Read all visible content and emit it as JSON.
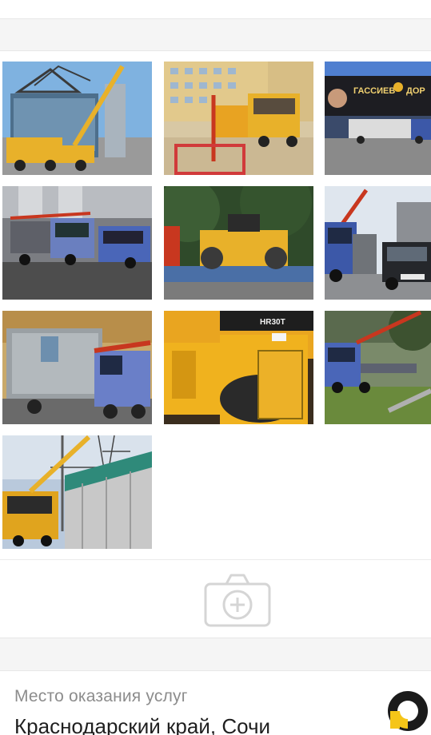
{
  "gallery": {
    "photos": [
      {
        "alt": "Кран-манипулятор у стеклянного здания",
        "icon": "photo-thumbnail"
      },
      {
        "alt": "Грузовик с краном у жилого дома",
        "icon": "photo-thumbnail"
      },
      {
        "alt": "Грузовик у рекламного экрана",
        "icon": "photo-thumbnail",
        "billboard_line1": "ГАССИЕВ",
        "billboard_line2": "ДОР"
      },
      {
        "alt": "Грузовики с манипулятором в ангаре",
        "icon": "photo-thumbnail"
      },
      {
        "alt": "Каток на платформе грузовика",
        "icon": "photo-thumbnail"
      },
      {
        "alt": "Синий грузовик с краном и внедорожник",
        "icon": "photo-thumbnail"
      },
      {
        "alt": "Перевозка бытовки краном-манипулятором",
        "icon": "photo-thumbnail"
      },
      {
        "alt": "Жёлтый дорожный каток крупным планом",
        "icon": "photo-thumbnail",
        "model": "HR30T"
      },
      {
        "alt": "Грузовик с краном на площадке",
        "icon": "photo-thumbnail"
      },
      {
        "alt": "Установка павильона краном",
        "icon": "photo-thumbnail"
      }
    ]
  },
  "add_photo": {
    "icon": "camera-plus-icon"
  },
  "location": {
    "label": "Место оказания услуг",
    "value": "Краснодарский край, Сочи"
  },
  "logo": {
    "icon": "brand-logo-icon"
  },
  "colors": {
    "band": "#f5f5f5",
    "truck_yellow": "#e8b12a",
    "truck_blue": "#3c58a8",
    "crane_red": "#c8371f",
    "logo_yellow": "#f5c518"
  }
}
